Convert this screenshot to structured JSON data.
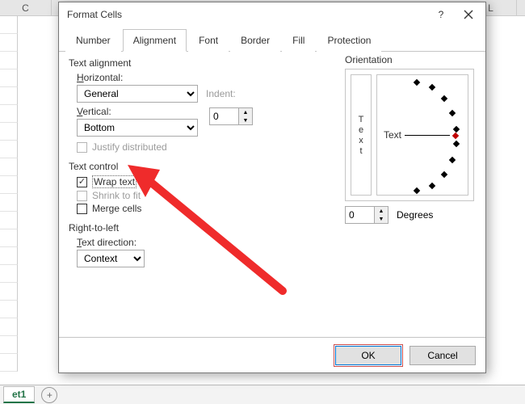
{
  "sheet": {
    "colC": "C",
    "colL": "L",
    "tab": "et1"
  },
  "dialog": {
    "title": "Format Cells",
    "tabs": {
      "number": "Number",
      "alignment": "Alignment",
      "font": "Font",
      "border": "Border",
      "fill": "Fill",
      "protection": "Protection"
    },
    "groups": {
      "text_alignment": "Text alignment",
      "text_control": "Text control",
      "rtl": "Right-to-left",
      "orientation": "Orientation"
    },
    "labels": {
      "horizontal_pre": "",
      "horizontal_ul": "H",
      "horizontal_post": "orizontal:",
      "vertical_pre": "",
      "vertical_ul": "V",
      "vertical_post": "ertical:",
      "indent_pre": "",
      "indent_ul": "I",
      "indent_post": "ndent:",
      "direction_pre": "",
      "direction_ul": "T",
      "direction_post": "ext direction:",
      "degrees_pre": "",
      "degrees_ul": "D",
      "degrees_post": "egrees"
    },
    "values": {
      "horizontal": "General",
      "vertical": "Bottom",
      "indent": "0",
      "direction": "Context",
      "degrees": "0"
    },
    "checks": {
      "justify": "Justify distributed",
      "wrap_pre": "",
      "wrap_ul": "W",
      "wrap_post": "rap text",
      "shrink": "Shrink to fit",
      "merge_pre": "",
      "merge_ul": "M",
      "merge_post": "erge cells"
    },
    "orient_text": "Text",
    "orient_vertical": {
      "t": "T",
      "e": "e",
      "x": "x",
      "t2": "t"
    },
    "buttons": {
      "ok": "OK",
      "cancel": "Cancel"
    }
  }
}
